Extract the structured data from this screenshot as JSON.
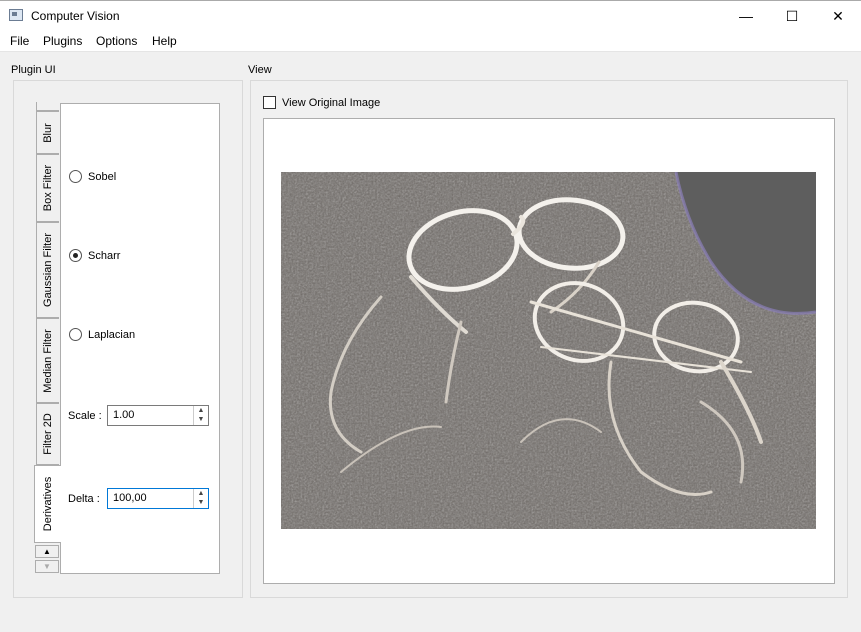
{
  "window": {
    "title": "Computer Vision",
    "minimize_glyph": "—",
    "maximize_glyph": "☐",
    "close_glyph": "✕"
  },
  "menu": {
    "file": "File",
    "plugins": "Plugins",
    "options": "Options",
    "help": "Help"
  },
  "plugin_ui": {
    "label": "Plugin UI",
    "tabs": [
      "Blur",
      "Box Filter",
      "Gaussian Filter",
      "Median Filter",
      "Filter 2D",
      "Derivatives"
    ],
    "active_tab": "Derivatives",
    "radios": [
      {
        "label": "Sobel",
        "checked": false
      },
      {
        "label": "Scharr",
        "checked": true
      },
      {
        "label": "Laplacian",
        "checked": false
      }
    ],
    "scale": {
      "label": "Scale :",
      "value": "1.00"
    },
    "delta": {
      "label": "Delta :",
      "value": "100,00"
    }
  },
  "view": {
    "label": "View",
    "view_original_label": "View Original Image",
    "view_original_checked": false
  },
  "colors": {
    "accent": "#0078d7",
    "image_bg": "#5e5c5b"
  },
  "icons": [
    "app-icon",
    "minimize-icon",
    "maximize-icon",
    "close-icon",
    "arrow-up-icon",
    "arrow-down-icon"
  ]
}
